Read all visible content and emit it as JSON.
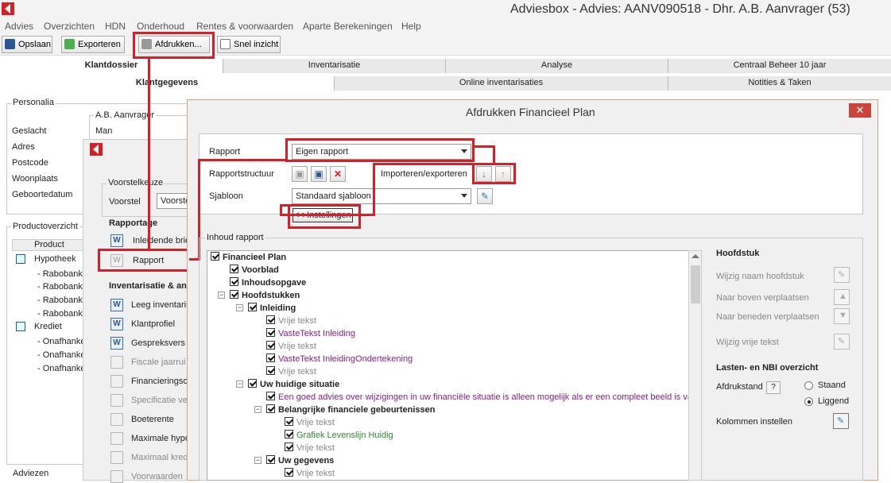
{
  "window": {
    "title": "Adviesbox - Advies: AANV090518 - Dhr. A.B. Aanvrager (53)"
  },
  "menu": [
    "Advies",
    "Overzichten",
    "HDN",
    "Onderhoud",
    "Rentes & voorwaarden",
    "Aparte Berekeningen",
    "Help"
  ],
  "toolbar": {
    "save": "Opslaan",
    "export": "Exporteren",
    "print": "Afdrukken...",
    "quick": "Snel inzicht"
  },
  "tabs_row1": [
    "Klantdossier",
    "Inventarisatie",
    "Analyse",
    "Centraal Beheer 10 jaar"
  ],
  "tabs_row2": [
    "Klantgegevens",
    "Online inventarisaties",
    "Notities & Taken"
  ],
  "personalia": {
    "heading": "Personalia",
    "client": "A.B. Aanvrager",
    "labels": [
      "Geslacht",
      "Adres",
      "Postcode",
      "Woonplaats",
      "Geboortedatum"
    ],
    "gender": "Man"
  },
  "products": {
    "heading": "Productoverzicht",
    "column": "Product",
    "rows": [
      "Hypotheek",
      "- Rabobank",
      "- Rabobank",
      "- Rabobank",
      "- Rabobank",
      "Krediet",
      "- Onafhanke",
      "- Onafhanke",
      "- Onafhanke"
    ]
  },
  "adviezen": "Adviezen",
  "bgdialog": {
    "voorstelkeuze": "Voorstelkeuze",
    "voorstel_label": "Voorstel",
    "voorstel_value": "Voorste",
    "rapportage": "Rapportage",
    "rap_items": [
      "Inleidende brie",
      "Rapport"
    ],
    "inv_heading": "Inventarisatie & an",
    "inv_items": [
      "Leeg inventaris",
      "Klantprofiel",
      "Gespreksvers",
      "Fiscale jaarrui",
      "Financieringso",
      "Specificatie ve",
      "Boeterente",
      "Maximale hypo",
      "Maximaal kredi",
      "Voorwaarden"
    ]
  },
  "dialog": {
    "title": "Afdrukken Financieel Plan",
    "close": "✕",
    "rapport_label": "Rapport",
    "rapport_value": "Eigen rapport",
    "structuur_label": "Rapportstructuur",
    "impexp_label": "Importeren/exporteren",
    "sjabloon_label": "Sjabloon",
    "sjabloon_value": "Standaard sjabloon",
    "instellingen": "<< Instellingen",
    "inhoud": "Inhoud rapport"
  },
  "tree": [
    {
      "text": "Financieel Plan",
      "style": "b"
    },
    {
      "text": "Voorblad",
      "style": "b"
    },
    {
      "text": "Inhoudsopgave",
      "style": "b"
    },
    {
      "text": "Hoofdstukken",
      "style": "b"
    },
    {
      "text": "Inleiding",
      "style": "b"
    },
    {
      "text": "Vrije tekst",
      "style": "gray"
    },
    {
      "text": "VasteTekst Inleiding",
      "style": "purple"
    },
    {
      "text": "Vrije tekst",
      "style": "gray"
    },
    {
      "text": "VasteTekst InleidingOndertekening",
      "style": "purple"
    },
    {
      "text": "Vrije tekst",
      "style": "gray"
    },
    {
      "text": "Uw huidige situatie",
      "style": "b"
    },
    {
      "text": "Een goed advies over wijzigingen in uw financiële situatie is alleen mogelijk als er een compleet beeld is van",
      "style": "purple"
    },
    {
      "text": "Belangrijke financiele gebeurtenissen",
      "style": "b"
    },
    {
      "text": "Vrije tekst",
      "style": "gray"
    },
    {
      "text": "Grafiek Levenslijn Huidig",
      "style": "green"
    },
    {
      "text": "Vrije tekst",
      "style": "gray"
    },
    {
      "text": "Uw gegevens",
      "style": "b"
    },
    {
      "text": "Vrije tekst",
      "style": "gray"
    }
  ],
  "right": {
    "hoofdstuk": "Hoofdstuk",
    "rename": "Wijzig naam hoofdstuk",
    "up": "Naar boven verplaatsen",
    "down": "Naar beneden verplaatsen",
    "freetext": "Wijzig vrije tekst",
    "lasten": "Lasten- en NBI overzicht",
    "afdrukstand": "Afdrukstand",
    "help": "?",
    "staand": "Staand",
    "liggend": "Liggend",
    "kolommen": "Kolommen instellen"
  },
  "colors": {
    "accent": "#d62027",
    "dialog_border": "#d9a079"
  }
}
